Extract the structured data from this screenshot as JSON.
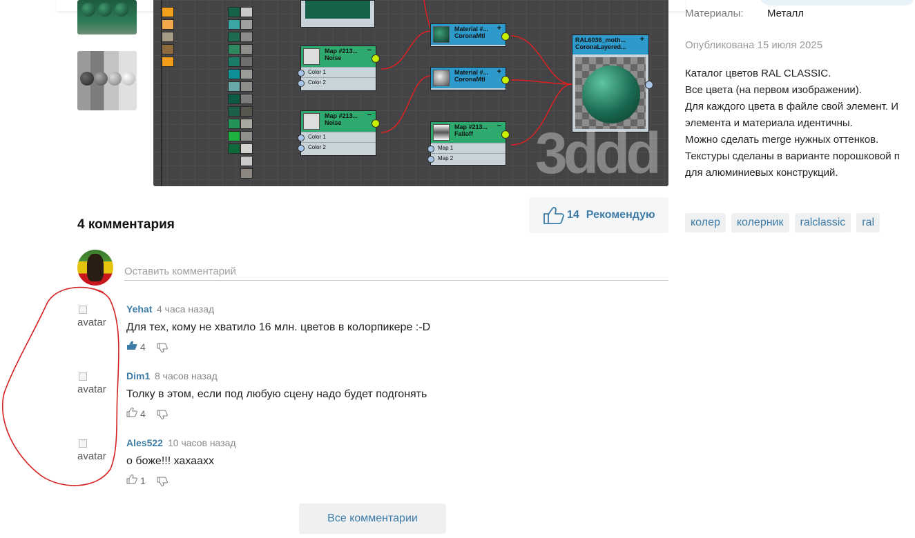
{
  "details": {
    "materials_label": "Материалы:",
    "materials_value": "Металл",
    "published": "Опубликована 15 июля 2025",
    "description": [
      "Каталог цветов RAL CLASSIC.",
      "Все цвета (на первом изображении).",
      "Для каждого цвета в файле свой элемент. И",
      "элемента и материала идентичны.",
      "Можно сделать merge нужных оттенков.",
      "Текстуры сделаны в варианте порошковой п",
      "для алюминиевых конструкций."
    ],
    "tags": [
      "колер",
      "колерник",
      "ralclassic",
      "ral"
    ]
  },
  "preview": {
    "nodes": {
      "noise1": {
        "title": "Map #213...",
        "sub": "Noise",
        "rows": [
          "Color 1",
          "Color 2"
        ]
      },
      "noise2": {
        "title": "Map #213...",
        "sub": "Noise",
        "rows": [
          "Color 1",
          "Color 2"
        ]
      },
      "mat1": {
        "title": "Material #...",
        "sub": "CoronaMtl"
      },
      "mat2": {
        "title": "Material #...",
        "sub": "CoronaMtl"
      },
      "falloff": {
        "title": "Map #213...",
        "sub": "Falloff",
        "rows": [
          "Map 1",
          "Map 2"
        ]
      },
      "layered": {
        "title": "RAL6036_moth...",
        "sub": "CoronaLayered..."
      }
    },
    "watermark": "3ddd"
  },
  "recommend": {
    "count": "14",
    "label": "Рекомендую"
  },
  "comments": {
    "title": "4 комментария",
    "input_placeholder": "Оставить комментарий",
    "avatar_alt": "avatar",
    "items": [
      {
        "author": "Yehat",
        "time": "4 часа назад",
        "text": "Для тех, кому не хватило 16 млн. цветов в колорпикере :-D",
        "likes": "4",
        "liked": true
      },
      {
        "author": "Dim1",
        "time": "8 часов назад",
        "text": "Толку в этом, если под любую сцену надо будет подгонять",
        "likes": "4",
        "liked": false
      },
      {
        "author": "Ales522",
        "time": "10 часов назад",
        "text": "о боже!!! хахаахх",
        "likes": "1",
        "liked": false
      }
    ],
    "all_button": "Все комментарии"
  },
  "colors": {
    "accent": "#3d7ca6",
    "annotation": "#d42020"
  }
}
